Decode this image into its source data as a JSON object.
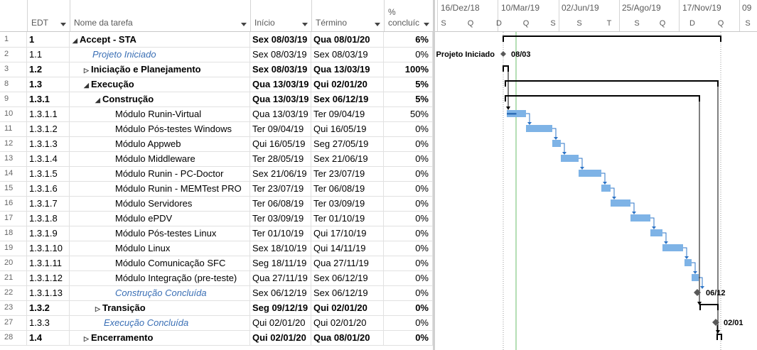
{
  "columns": {
    "edt": "EDT",
    "name": "Nome da tarefa",
    "inicio": "Início",
    "termino": "Término",
    "pct_top": "%",
    "pct_bottom": "concluíc"
  },
  "timescale": {
    "top": [
      "16/Dez/18",
      "10/Mar/19",
      "02/Jun/19",
      "25/Ago/19",
      "17/Nov/19",
      "09"
    ],
    "bottom": [
      "S",
      "Q",
      "D",
      "Q",
      "S",
      "S",
      "T",
      "S",
      "Q",
      "D",
      "Q",
      "S"
    ]
  },
  "tasks": [
    {
      "num": "1",
      "edt": "1",
      "name": "Accept - STA",
      "ini": "Sex 08/03/19",
      "ter": "Qua 08/01/20",
      "pct": "6%",
      "level": 0,
      "summary": true,
      "milestone": false,
      "toggle": "▲"
    },
    {
      "num": "2",
      "edt": "1.1",
      "name": "Projeto Iniciado",
      "ini": "Sex 08/03/19",
      "ter": "Sex 08/03/19",
      "pct": "0%",
      "level": 1,
      "summary": false,
      "milestone": true,
      "toggle": ""
    },
    {
      "num": "3",
      "edt": "1.2",
      "name": "Iniciação e Planejamento",
      "ini": "Sex 08/03/19",
      "ter": "Qua 13/03/19",
      "pct": "100%",
      "level": 1,
      "summary": true,
      "milestone": false,
      "toggle": "▷"
    },
    {
      "num": "8",
      "edt": "1.3",
      "name": "Execução",
      "ini": "Qua 13/03/19",
      "ter": "Qui 02/01/20",
      "pct": "5%",
      "level": 1,
      "summary": true,
      "milestone": false,
      "toggle": "▲"
    },
    {
      "num": "9",
      "edt": "1.3.1",
      "name": "Construção",
      "ini": "Qua 13/03/19",
      "ter": "Sex 06/12/19",
      "pct": "5%",
      "level": 2,
      "summary": true,
      "milestone": false,
      "toggle": "▲"
    },
    {
      "num": "10",
      "edt": "1.3.1.1",
      "name": "Módulo Runin-Virtual",
      "ini": "Qua 13/03/19",
      "ter": "Ter 09/04/19",
      "pct": "50%",
      "level": 3,
      "summary": false,
      "milestone": false,
      "toggle": ""
    },
    {
      "num": "11",
      "edt": "1.3.1.2",
      "name": "Módulo Pós-testes Windows",
      "ini": "Ter 09/04/19",
      "ter": "Qui 16/05/19",
      "pct": "0%",
      "level": 3,
      "summary": false,
      "milestone": false,
      "toggle": ""
    },
    {
      "num": "12",
      "edt": "1.3.1.3",
      "name": "Módulo Appweb",
      "ini": "Qui 16/05/19",
      "ter": "Seg 27/05/19",
      "pct": "0%",
      "level": 3,
      "summary": false,
      "milestone": false,
      "toggle": ""
    },
    {
      "num": "13",
      "edt": "1.3.1.4",
      "name": "Módulo Middleware",
      "ini": "Ter 28/05/19",
      "ter": "Sex 21/06/19",
      "pct": "0%",
      "level": 3,
      "summary": false,
      "milestone": false,
      "toggle": ""
    },
    {
      "num": "14",
      "edt": "1.3.1.5",
      "name": "Módulo Runin - PC-Doctor",
      "ini": "Sex 21/06/19",
      "ter": "Ter 23/07/19",
      "pct": "0%",
      "level": 3,
      "summary": false,
      "milestone": false,
      "toggle": ""
    },
    {
      "num": "15",
      "edt": "1.3.1.6",
      "name": "Módulo Runin - MEMTest PRO",
      "ini": "Ter 23/07/19",
      "ter": "Ter 06/08/19",
      "pct": "0%",
      "level": 3,
      "summary": false,
      "milestone": false,
      "toggle": ""
    },
    {
      "num": "16",
      "edt": "1.3.1.7",
      "name": "Módulo Servidores",
      "ini": "Ter 06/08/19",
      "ter": "Ter 03/09/19",
      "pct": "0%",
      "level": 3,
      "summary": false,
      "milestone": false,
      "toggle": ""
    },
    {
      "num": "17",
      "edt": "1.3.1.8",
      "name": "Módulo ePDV",
      "ini": "Ter 03/09/19",
      "ter": "Ter 01/10/19",
      "pct": "0%",
      "level": 3,
      "summary": false,
      "milestone": false,
      "toggle": ""
    },
    {
      "num": "18",
      "edt": "1.3.1.9",
      "name": "Módulo Pós-testes Linux",
      "ini": "Ter 01/10/19",
      "ter": "Qui 17/10/19",
      "pct": "0%",
      "level": 3,
      "summary": false,
      "milestone": false,
      "toggle": ""
    },
    {
      "num": "19",
      "edt": "1.3.1.10",
      "name": "Módulo Linux",
      "ini": "Sex 18/10/19",
      "ter": "Qui 14/11/19",
      "pct": "0%",
      "level": 3,
      "summary": false,
      "milestone": false,
      "toggle": ""
    },
    {
      "num": "20",
      "edt": "1.3.1.11",
      "name": "Módulo Comunicação SFC",
      "ini": "Seg 18/11/19",
      "ter": "Qua 27/11/19",
      "pct": "0%",
      "level": 3,
      "summary": false,
      "milestone": false,
      "toggle": ""
    },
    {
      "num": "21",
      "edt": "1.3.1.12",
      "name": "Módulo Integração (pre-teste)",
      "ini": "Qua 27/11/19",
      "ter": "Sex 06/12/19",
      "pct": "0%",
      "level": 3,
      "summary": false,
      "milestone": false,
      "toggle": ""
    },
    {
      "num": "22",
      "edt": "1.3.1.13",
      "name": "Construção Concluída",
      "ini": "Sex 06/12/19",
      "ter": "Sex 06/12/19",
      "pct": "0%",
      "level": 3,
      "summary": false,
      "milestone": true,
      "toggle": ""
    },
    {
      "num": "23",
      "edt": "1.3.2",
      "name": "Transição",
      "ini": "Seg 09/12/19",
      "ter": "Qui 02/01/20",
      "pct": "0%",
      "level": 2,
      "summary": true,
      "milestone": false,
      "toggle": "▷"
    },
    {
      "num": "27",
      "edt": "1.3.3",
      "name": "Execução Concluída",
      "ini": "Qui 02/01/20",
      "ter": "Qui 02/01/20",
      "pct": "0%",
      "level": 2,
      "summary": false,
      "milestone": true,
      "toggle": ""
    },
    {
      "num": "28",
      "edt": "1.4",
      "name": "Encerramento",
      "ini": "Qui 02/01/20",
      "ter": "Qua 08/01/20",
      "pct": "0%",
      "level": 1,
      "summary": true,
      "milestone": false,
      "toggle": "▷"
    }
  ],
  "gantt_labels": {
    "projeto_iniciado_name": "Projeto Iniciado",
    "projeto_iniciado_date": "08/03",
    "construcao_date": "06/12",
    "execucao_date": "02/01"
  },
  "colors": {
    "task_bar": "#7eb3e6",
    "progress": "#2e6fb8",
    "milestone": "#595959",
    "summary": "#000000",
    "today_line": "#6bbf6b",
    "link_arrow": "#2e75c7"
  }
}
